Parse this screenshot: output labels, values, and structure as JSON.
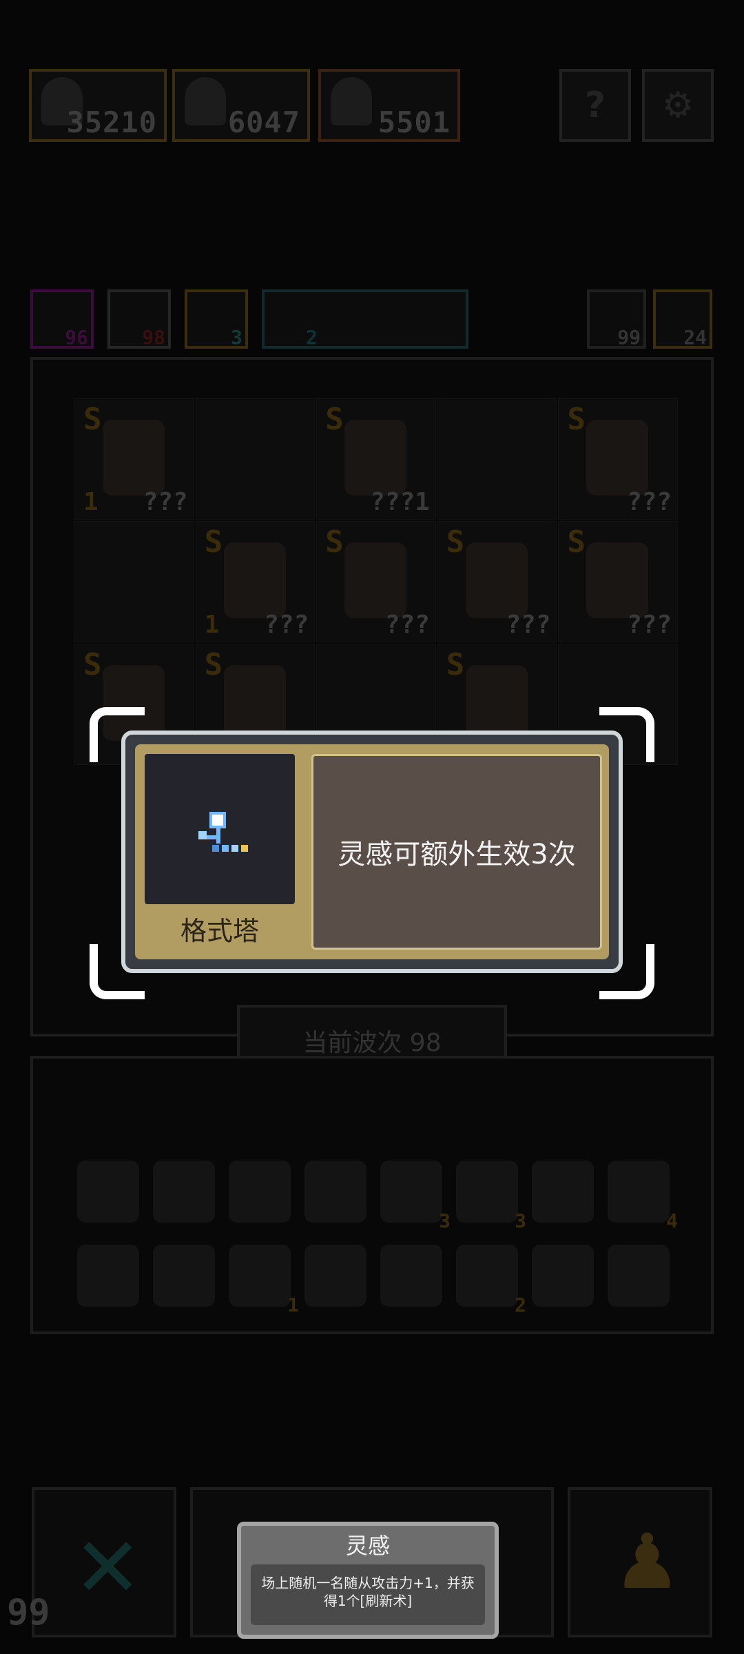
{
  "resources": [
    {
      "icon": "water-drop-icon",
      "value": "35210",
      "color": "#3a2d10"
    },
    {
      "icon": "skull-icon",
      "value": "6047",
      "color": "#3a2d10"
    },
    {
      "icon": "skull-icon",
      "value": "5501",
      "color": "#3d2112"
    }
  ],
  "top_buttons": {
    "help": "?",
    "settings": "⚙"
  },
  "stat_chips": [
    {
      "icon": "magic-icon",
      "value": "96",
      "color": "#3b0d3d"
    },
    {
      "icon": "monster-icon",
      "value": "98",
      "color": "#3a0e0e"
    },
    {
      "icon": "lightning-icon",
      "value": "3",
      "color": "#123a33"
    },
    {
      "icon": "clock-icon",
      "value": "2",
      "color": "#0f3234"
    }
  ],
  "side_chips": [
    {
      "icon": "refresh-icon",
      "value": "99"
    },
    {
      "icon": "key-icon",
      "value": "24"
    }
  ],
  "board": {
    "cells": [
      {
        "rank": "S",
        "qty": "1",
        "tag": "???"
      },
      {
        "rank": "",
        "qty": "",
        "tag": ""
      },
      {
        "rank": "S",
        "qty": "",
        "tag": "???1"
      },
      {
        "rank": "",
        "qty": "",
        "tag": ""
      },
      {
        "rank": "S",
        "qty": "",
        "tag": "???"
      },
      {
        "rank": "",
        "qty": "",
        "tag": ""
      },
      {
        "rank": "S",
        "qty": "1",
        "tag": "???"
      },
      {
        "rank": "S",
        "qty": "",
        "tag": "???"
      },
      {
        "rank": "S",
        "qty": "",
        "tag": "???"
      },
      {
        "rank": "S",
        "qty": "",
        "tag": "???"
      },
      {
        "rank": "S",
        "qty": "",
        "tag": ""
      },
      {
        "rank": "S",
        "qty": "",
        "tag": ""
      },
      {
        "rank": "",
        "qty": "",
        "tag": ""
      },
      {
        "rank": "S",
        "qty": "",
        "tag": ""
      },
      {
        "rank": "",
        "qty": "",
        "tag": ""
      }
    ]
  },
  "wave_label": "当前波次 98",
  "inventory": {
    "items": [
      {
        "icon": "shield-icon",
        "count": ""
      },
      {
        "icon": "helmet-icon",
        "count": ""
      },
      {
        "icon": "mask-icon",
        "count": ""
      },
      {
        "icon": "armor-icon",
        "count": ""
      },
      {
        "icon": "tower-icon",
        "count": "3"
      },
      {
        "icon": "statue-icon",
        "count": "3"
      },
      {
        "icon": "format-tower-icon",
        "count": ""
      },
      {
        "icon": "water-drop-icon",
        "count": "4"
      },
      {
        "icon": "wand-icon",
        "count": ""
      },
      {
        "icon": "potion-icon",
        "count": ""
      },
      {
        "icon": "book-icon",
        "count": "1"
      },
      {
        "icon": "eye-icon",
        "count": ""
      },
      {
        "icon": "frame-icon",
        "count": ""
      },
      {
        "icon": "planet-icon",
        "count": "2"
      },
      {
        "icon": "chest-icon",
        "count": ""
      },
      {
        "icon": "lock-icon",
        "count": ""
      }
    ]
  },
  "level_number": "99",
  "highlight_card": {
    "name": "格式塔",
    "description": "灵感可额外生效3次",
    "icon": "format-tower-icon"
  },
  "tooltip": {
    "title": "灵感",
    "body": "场上随机一名随从攻击力+1，并获得1个[刷新术]"
  }
}
